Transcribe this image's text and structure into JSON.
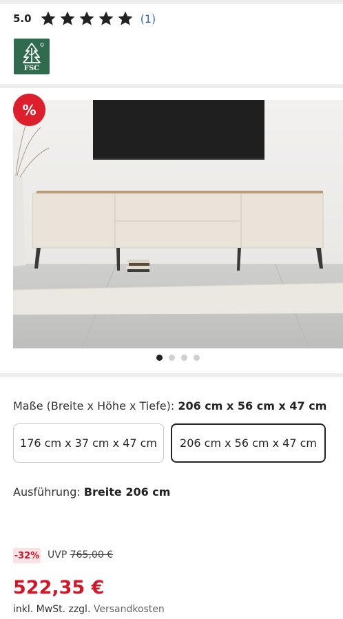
{
  "rating": {
    "score": "5.0",
    "stars": 5,
    "count": "(1)"
  },
  "certification": {
    "label": "FSC",
    "color": "#2f6b4c"
  },
  "gallery": {
    "badge": "%",
    "image_count": 4,
    "active_index": 0
  },
  "dimensions": {
    "label": "Maße (Breite x Höhe x Tiefe):",
    "selected": "206 cm x 56 cm x 47 cm",
    "options": [
      "176 cm x 37 cm x 47 cm",
      "206 cm x 56 cm x 47 cm"
    ]
  },
  "variant": {
    "label": "Ausführung:",
    "value": "Breite 206 cm"
  },
  "pricing": {
    "discount": "-32%",
    "uvp_label": "UVP",
    "uvp_price": "765,00 €",
    "price": "522,35 €",
    "tax_text": "inkl. MwSt. zzgl.",
    "shipping_link": "Versandkosten"
  },
  "colors": {
    "accent_red": "#d0182a",
    "link_blue": "#3b6cc9"
  }
}
